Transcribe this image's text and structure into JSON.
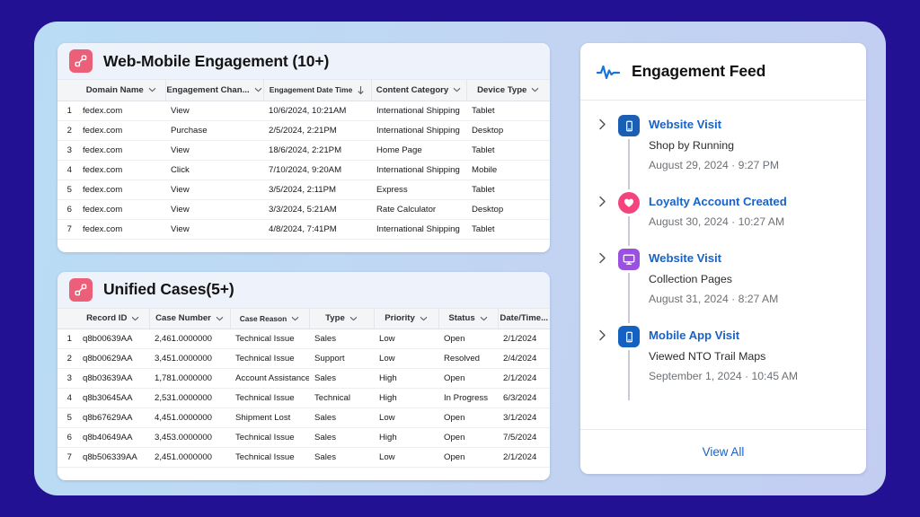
{
  "theme": {
    "backdrop": "#231193",
    "panel_gradient_from": "#b9dcf4",
    "panel_gradient_to": "#c3cdf2",
    "accent_pink": "#ec5f79",
    "link_blue": "#1763c8",
    "grid_link_blue": "#3a74d8"
  },
  "engagement_card": {
    "icon": "related-records-icon",
    "title": "Web-Mobile Engagement (10+)",
    "columns": [
      {
        "label": "Domain Name",
        "sort": "chevron-down-icon"
      },
      {
        "label": "Engagement Chan...",
        "sort": "chevron-down-icon"
      },
      {
        "label": "Engagement Date Time",
        "sort": "arrow-down-icon"
      },
      {
        "label": "Content Category",
        "sort": "chevron-down-icon"
      },
      {
        "label": "Device Type",
        "sort": "chevron-down-icon"
      }
    ],
    "rows": [
      {
        "n": "1",
        "domain": "fedex.com",
        "channel": "View",
        "datetime": "10/6/2024, 10:21AM",
        "category": "International Shipping",
        "device": "Tablet"
      },
      {
        "n": "2",
        "domain": "fedex.com",
        "channel": "Purchase",
        "datetime": "2/5/2024, 2:21PM",
        "category": "International Shipping",
        "device": "Desktop"
      },
      {
        "n": "3",
        "domain": "fedex.com",
        "channel": "View",
        "datetime": "18/6/2024, 2:21PM",
        "category": "Home Page",
        "device": "Tablet"
      },
      {
        "n": "4",
        "domain": "fedex.com",
        "channel": "Click",
        "datetime": "7/10/2024, 9:20AM",
        "category": "International Shipping",
        "device": "Mobile"
      },
      {
        "n": "5",
        "domain": "fedex.com",
        "channel": "View",
        "datetime": "3/5/2024, 2:11PM",
        "category": "Express",
        "device": "Tablet"
      },
      {
        "n": "6",
        "domain": "fedex.com",
        "channel": "View",
        "datetime": "3/3/2024, 5:21AM",
        "category": "Rate Calculator",
        "device": "Desktop"
      },
      {
        "n": "7",
        "domain": "fedex.com",
        "channel": "View",
        "datetime": "4/8/2024, 7:41PM",
        "category": "International Shipping",
        "device": "Tablet"
      }
    ]
  },
  "cases_card": {
    "icon": "related-records-icon",
    "title": "Unified Cases(5+)",
    "columns": [
      {
        "label": "Record ID",
        "sort": "chevron-down-icon"
      },
      {
        "label": "Case Number",
        "sort": "chevron-down-icon"
      },
      {
        "label": "Case Reason",
        "sort": "chevron-down-icon"
      },
      {
        "label": "Type",
        "sort": "chevron-down-icon"
      },
      {
        "label": "Priority",
        "sort": "chevron-down-icon"
      },
      {
        "label": "Status",
        "sort": "chevron-down-icon"
      },
      {
        "label": "Date/Time...",
        "sort": "none"
      }
    ],
    "rows": [
      {
        "n": "1",
        "record_id": "q8b00639AA",
        "case_number": "2,461.0000000",
        "case_reason": "Technical Issue",
        "type": "Sales",
        "priority": "Low",
        "status": "Open",
        "date": "2/1/2024"
      },
      {
        "n": "2",
        "record_id": "q8b00629AA",
        "case_number": "3,451.0000000",
        "case_reason": "Technical Issue",
        "type": "Support",
        "priority": "Low",
        "status": "Resolved",
        "date": "2/4/2024"
      },
      {
        "n": "3",
        "record_id": "q8b03639AA",
        "case_number": "1,781.0000000",
        "case_reason": "Account Assistance",
        "type": "Sales",
        "priority": "High",
        "status": "Open",
        "date": "2/1/2024"
      },
      {
        "n": "4",
        "record_id": "q8b30645AA",
        "case_number": "2,531.0000000",
        "case_reason": "Technical Issue",
        "type": "Technical",
        "priority": "High",
        "status": "In Progress",
        "date": "6/3/2024"
      },
      {
        "n": "5",
        "record_id": "q8b67629AA",
        "case_number": "4,451.0000000",
        "case_reason": "Shipment Lost",
        "type": "Sales",
        "priority": "Low",
        "status": "Open",
        "date": "3/1/2024"
      },
      {
        "n": "6",
        "record_id": "q8b40649AA",
        "case_number": "3,453.0000000",
        "case_reason": "Technical Issue",
        "type": "Sales",
        "priority": "High",
        "status": "Open",
        "date": "7/5/2024"
      },
      {
        "n": "7",
        "record_id": "q8b506339AA",
        "case_number": "2,451.0000000",
        "case_reason": "Technical Issue",
        "type": "Sales",
        "priority": "Low",
        "status": "Open",
        "date": "2/1/2024"
      }
    ]
  },
  "feed": {
    "icon": "activity-pulse-icon",
    "title": "Engagement Feed",
    "items": [
      {
        "icon": "mobile-phone-icon",
        "icon_shape": "square",
        "icon_color": "#1a5fb4",
        "title": "Website Visit",
        "subtitle": "Shop by Running",
        "date": "August 29, 2024 · 9:27 PM",
        "expand": "chevron-right-icon"
      },
      {
        "icon": "heart-icon",
        "icon_shape": "circle",
        "icon_color": "#f5437e",
        "title": "Loyalty Account Created",
        "subtitle": "",
        "date": "August 30, 2024 · 10:27 AM",
        "expand": "chevron-right-icon"
      },
      {
        "icon": "desktop-monitor-icon",
        "icon_shape": "square",
        "icon_color": "#9b51e0",
        "title": "Website Visit",
        "subtitle": "Collection Pages",
        "date": "August 31, 2024 · 8:27 AM",
        "expand": "chevron-right-icon"
      },
      {
        "icon": "mobile-phone-icon",
        "icon_shape": "square",
        "icon_color": "#1461c1",
        "title": "Mobile App Visit",
        "subtitle": "Viewed NTO Trail Maps",
        "date": "September 1, 2024 · 10:45 AM",
        "expand": "chevron-right-icon"
      }
    ],
    "view_all_label": "View All"
  }
}
